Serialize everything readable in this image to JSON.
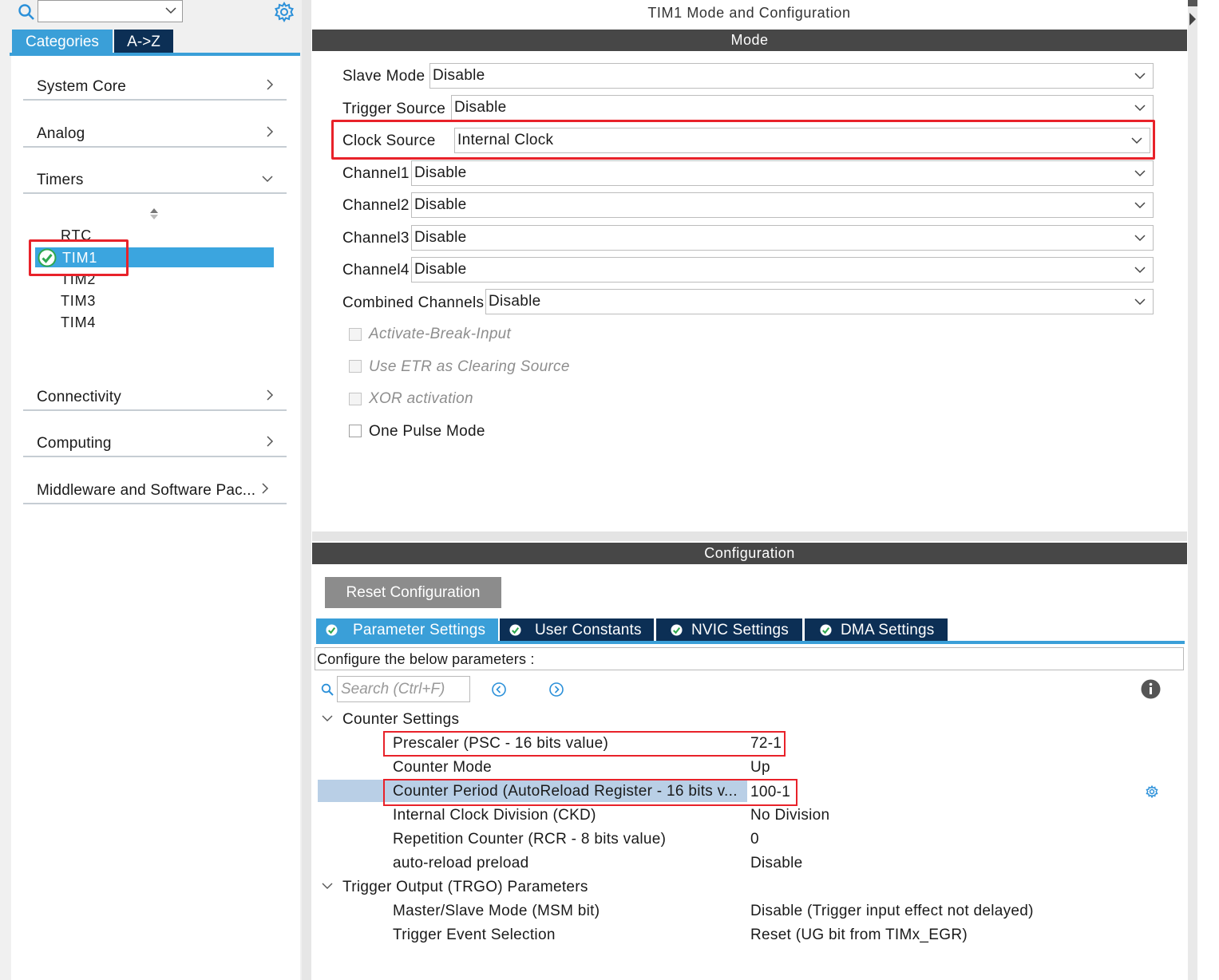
{
  "left_panel": {
    "search_value": "",
    "tabs": {
      "categories": "Categories",
      "az": "A->Z"
    },
    "categories": [
      "System Core",
      "Analog",
      "Timers",
      "Connectivity",
      "Computing",
      "Middleware and Software Pac..."
    ],
    "timers": [
      "RTC",
      "TIM1",
      "TIM2",
      "TIM3",
      "TIM4"
    ],
    "selected_timer": "TIM1"
  },
  "main": {
    "title": "TIM1 Mode and Configuration",
    "mode_header": "Mode",
    "mode_fields": [
      {
        "label": "Slave Mode",
        "value": "Disable"
      },
      {
        "label": "Trigger Source",
        "value": "Disable"
      },
      {
        "label": "Clock Source",
        "value": "Internal Clock"
      },
      {
        "label": "Channel1",
        "value": "Disable"
      },
      {
        "label": "Channel2",
        "value": "Disable"
      },
      {
        "label": "Channel3",
        "value": "Disable"
      },
      {
        "label": "Channel4",
        "value": "Disable"
      },
      {
        "label": "Combined Channels",
        "value": "Disable"
      }
    ],
    "checkboxes": [
      {
        "label": "Activate-Break-Input",
        "checked": false,
        "enabled": false
      },
      {
        "label": "Use ETR as Clearing Source",
        "checked": false,
        "enabled": false
      },
      {
        "label": "XOR activation",
        "checked": false,
        "enabled": false
      },
      {
        "label": "One Pulse Mode",
        "checked": false,
        "enabled": true
      }
    ],
    "config_header": "Configuration",
    "reset_button": "Reset Configuration",
    "config_tabs": [
      "Parameter Settings",
      "User Constants",
      "NVIC Settings",
      "DMA Settings"
    ],
    "active_tab": "Parameter Settings",
    "configure_text": "Configure the below parameters :",
    "search_placeholder": "Search (Ctrl+F)",
    "groups": [
      {
        "name": "Counter Settings",
        "params": [
          {
            "name": "Prescaler (PSC - 16 bits value)",
            "value": "72-1"
          },
          {
            "name": "Counter Mode",
            "value": "Up"
          },
          {
            "name": "Counter Period (AutoReload Register - 16 bits v...",
            "value": "100-1"
          },
          {
            "name": "Internal Clock Division (CKD)",
            "value": "No Division"
          },
          {
            "name": "Repetition Counter (RCR - 8 bits value)",
            "value": "0"
          },
          {
            "name": "auto-reload preload",
            "value": "Disable"
          }
        ]
      },
      {
        "name": "Trigger Output (TRGO) Parameters",
        "params": [
          {
            "name": "Master/Slave Mode (MSM bit)",
            "value": "Disable (Trigger input effect not delayed)"
          },
          {
            "name": "Trigger Event Selection",
            "value": "Reset (UG bit from TIMx_EGR)"
          }
        ]
      }
    ]
  },
  "colors": {
    "accent": "#3a9fd8",
    "dark_tab": "#0c2f55",
    "header_bar": "#474747",
    "highlight": "#e8222a",
    "selected_row": "#b9cfe6"
  }
}
